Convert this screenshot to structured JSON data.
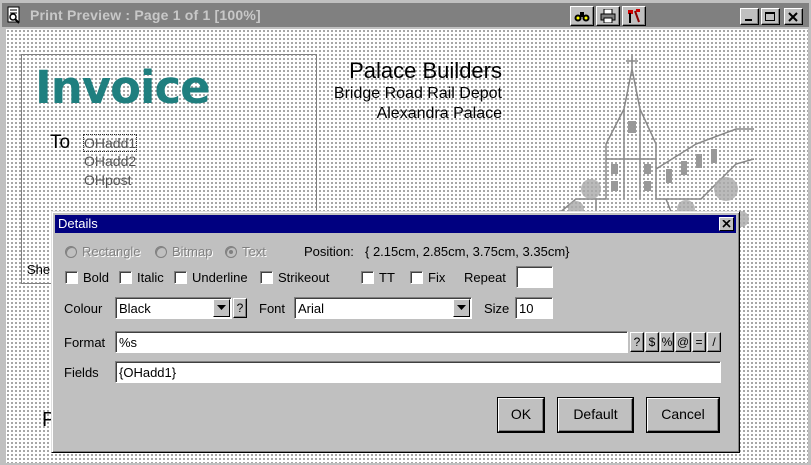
{
  "window": {
    "title": "Print Preview : Page 1 of 1 [100%]",
    "toolbar": [
      "binoculars-icon",
      "printer-icon",
      "tools-icon"
    ],
    "controls": [
      "minimize",
      "maximize",
      "close"
    ]
  },
  "preview": {
    "invoice_title": "Invoice",
    "to_label": "To",
    "address_lines": [
      "OHadd1",
      "OHadd2",
      "OHpost"
    ],
    "company_name": "Palace Builders",
    "company_line2": "Bridge Road Rail Depot",
    "company_line3": "Alexandra Palace",
    "partial_label": "She",
    "partial_big": "P"
  },
  "dialog": {
    "title": "Details",
    "type_options": [
      "Rectangle",
      "Bitmap",
      "Text"
    ],
    "selected_type": "Text",
    "position_label": "Position:",
    "position_value": "{ 2.15cm, 2.85cm, 3.75cm, 3.35cm}",
    "style_checks": [
      "Bold",
      "Italic",
      "Underline",
      "Strikeout"
    ],
    "extra_checks": [
      "TT",
      "Fix"
    ],
    "repeat_label": "Repeat",
    "repeat_value": "",
    "colour_label": "Colour",
    "colour_value": "Black",
    "colour_help": "?",
    "font_label": "Font",
    "font_value": "Arial",
    "size_label": "Size",
    "size_value": "10",
    "format_label": "Format",
    "format_value": "%s",
    "format_buttons": [
      "?",
      "$",
      "%",
      "@",
      "=",
      "/"
    ],
    "fields_label": "Fields",
    "fields_value": "{OHadd1}",
    "ok_label": "OK",
    "default_label": "Default",
    "cancel_label": "Cancel"
  },
  "colors": {
    "invoice_title": "#1f7f7f",
    "dialog_titlebar": "#000080",
    "inactive_titlebar": "#808080",
    "face": "#c0c0c0"
  }
}
